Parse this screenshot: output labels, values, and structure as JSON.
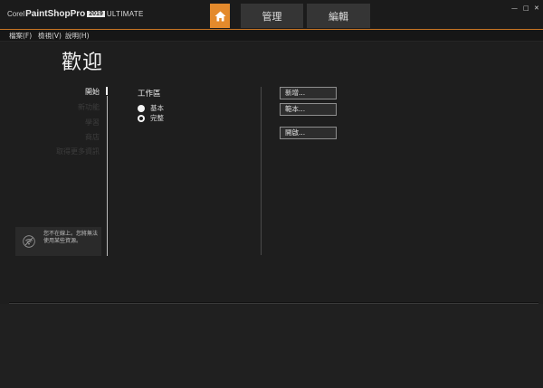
{
  "app": {
    "corel": "Corel",
    "name": "PaintShop",
    "pro": "Pro",
    "year": "2019",
    "edition": "ULTIMATE"
  },
  "tabs": {
    "manage": "管理",
    "edit": "編輯"
  },
  "window_controls": {
    "minimize": "—",
    "maximize": "□",
    "close": "✕"
  },
  "menu": {
    "file": "檔案(F)",
    "view": "檢視(V)",
    "help": "說明(H)"
  },
  "welcome": {
    "title": "歡迎"
  },
  "nav": {
    "items": [
      {
        "label": "開始",
        "active": true
      },
      {
        "label": "新功能",
        "active": false
      },
      {
        "label": "學習",
        "active": false
      },
      {
        "label": "商店",
        "active": false
      },
      {
        "label": "取得更多資訊",
        "active": false
      }
    ]
  },
  "offline": {
    "message": "您不在線上。您將無法使用某些資源。"
  },
  "workspace": {
    "title": "工作區",
    "options": [
      {
        "label": "基本",
        "checked": false
      },
      {
        "label": "完整",
        "checked": true
      }
    ]
  },
  "actions": {
    "new": "新增...",
    "template": "範本...",
    "open": "開啟..."
  },
  "colors": {
    "accent": "#e48a2c",
    "background": "#1e1e1e",
    "tab": "#353535"
  },
  "icons": {
    "home": "home-icon",
    "offline": "no-wifi-icon"
  }
}
